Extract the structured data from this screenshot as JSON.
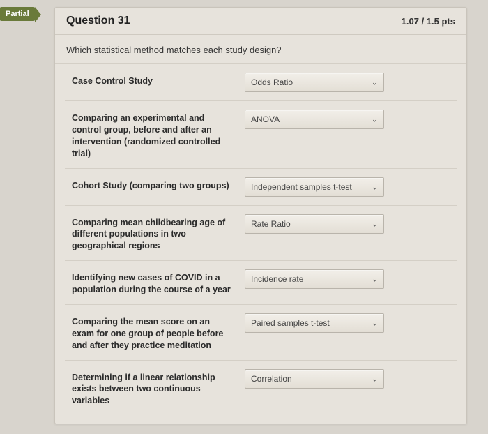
{
  "badge": "Partial",
  "header": {
    "title": "Question 31",
    "points": "1.07 / 1.5 pts"
  },
  "prompt": "Which statistical method matches each study design?",
  "rows": [
    {
      "label": "Case Control Study",
      "answer": "Odds Ratio"
    },
    {
      "label": "Comparing an experimental and control group, before and after an intervention (randomized controlled trial)",
      "answer": "ANOVA"
    },
    {
      "label": "Cohort Study (comparing two groups)",
      "answer": "Independent samples t-test"
    },
    {
      "label": "Comparing mean childbearing age of different populations in two geographical regions",
      "answer": "Rate Ratio"
    },
    {
      "label": "Identifying new cases of COVID in a population during the course of a year",
      "answer": "Incidence rate"
    },
    {
      "label": "Comparing the mean score on an exam for one group of people before and after they practice meditation",
      "answer": "Paired samples t-test"
    },
    {
      "label": "Determining if a linear relationship exists between two continuous variables",
      "answer": "Correlation"
    }
  ]
}
